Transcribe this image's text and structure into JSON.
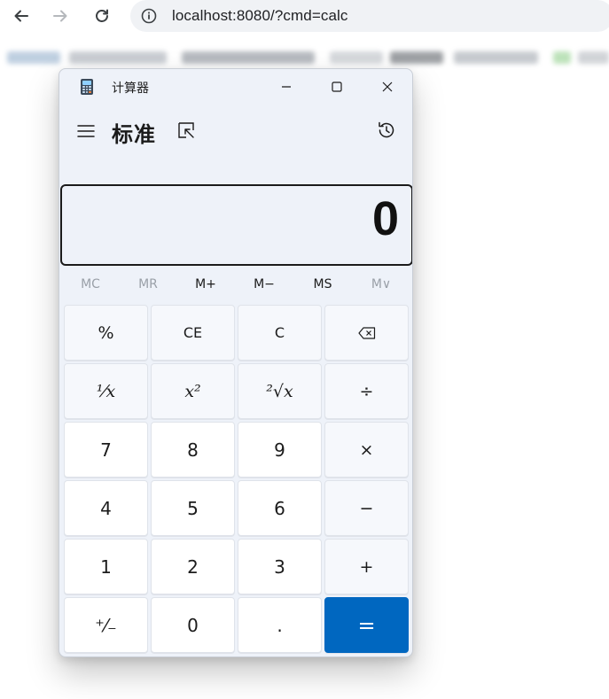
{
  "browser": {
    "url": "localhost:8080/?cmd=calc",
    "icons": {
      "back": "arrow-left-icon",
      "forward": "arrow-right-icon",
      "reload": "reload-icon",
      "info": "info-icon"
    }
  },
  "calculator": {
    "window_title": "计算器",
    "mode": "标准",
    "display_value": "0",
    "memory_buttons": [
      {
        "label": "MC",
        "enabled": false
      },
      {
        "label": "MR",
        "enabled": false
      },
      {
        "label": "M+",
        "enabled": true
      },
      {
        "label": "M−",
        "enabled": true
      },
      {
        "label": "MS",
        "enabled": true
      },
      {
        "label": "M∨",
        "enabled": false
      }
    ],
    "keys": {
      "percent": "%",
      "clear_entry": "CE",
      "clear": "C",
      "backspace": "⌫",
      "reciprocal": "¹⁄x",
      "square": "x²",
      "sqrt": "²√x",
      "divide": "÷",
      "seven": "7",
      "eight": "8",
      "nine": "9",
      "multiply": "×",
      "four": "4",
      "five": "5",
      "six": "6",
      "subtract": "−",
      "one": "1",
      "two": "2",
      "three": "3",
      "add": "+",
      "negate": "⁺⁄₋",
      "zero": "0",
      "decimal": ".",
      "equals": "="
    },
    "colors": {
      "accent": "#0067c0",
      "window_bg": "#eef2f9",
      "key_bg": "#ffffff",
      "op_key_bg": "#f6f8fc"
    }
  }
}
